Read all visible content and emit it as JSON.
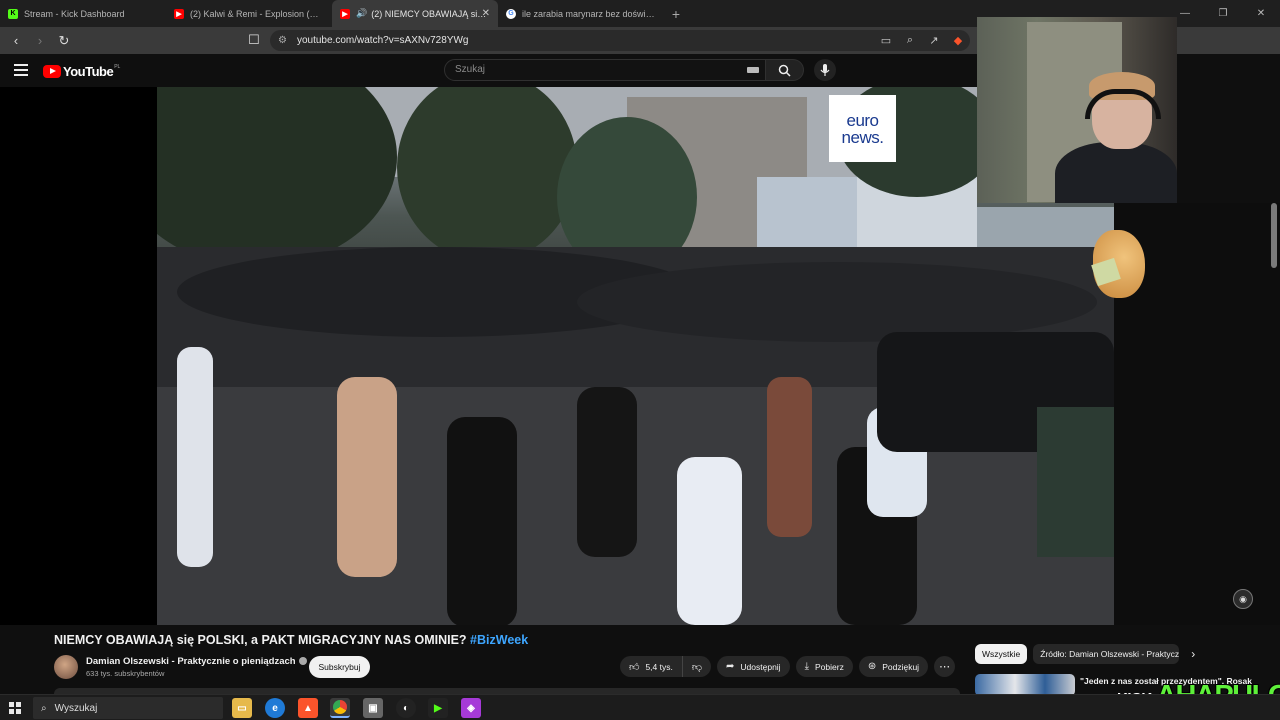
{
  "browser": {
    "tabs": [
      {
        "title": "Stream - Kick Dashboard",
        "favicon": "kick-icon",
        "color": "#53fc18"
      },
      {
        "title": "(2) Kalwi & Remi - Explosion (Theo R",
        "favicon": "youtube-icon",
        "color": "#ff0000"
      },
      {
        "title": "(2) NIEMCY OBAWIAJĄ się PO",
        "favicon": "youtube-icon",
        "color": "#ff0000"
      },
      {
        "title": "ile zarabia marynarz bez doświadcze",
        "favicon": "google-icon",
        "color": "#4285f4"
      }
    ],
    "new_tab": "+",
    "url": "youtube.com/watch?v=sAXNv728YWg"
  },
  "youtube": {
    "logo": "YouTube",
    "country": "PL",
    "search_placeholder": "Szukaj"
  },
  "video": {
    "watermark_line1": "euro",
    "watermark_line2": "news."
  },
  "watch": {
    "title": "NIEMCY OBAWIAJĄ się POLSKI, a PAKT MIGRACYJNY NAS OMINIE?",
    "hashtag": "#BizWeek",
    "channel_name": "Damian Olszewski - Praktycznie o pieniądzach",
    "subscribers": "633 tys. subskrybentów",
    "subscribe": "Subskrybuj",
    "likes": "5,4 tys.",
    "share": "Udostępnij",
    "download": "Pobierz",
    "thanks": "Podziękuj"
  },
  "chips": {
    "all": "Wszystkie",
    "source": "Źródło: Damian Olszewski - Praktyczn"
  },
  "recommendation": {
    "title": "\"Jeden z nas został przezydentem\". Rosak"
  },
  "overlay": {
    "kick": "KICK",
    "streamer": "AHAPULCO"
  },
  "taskbar": {
    "search": "Wyszukaj"
  }
}
